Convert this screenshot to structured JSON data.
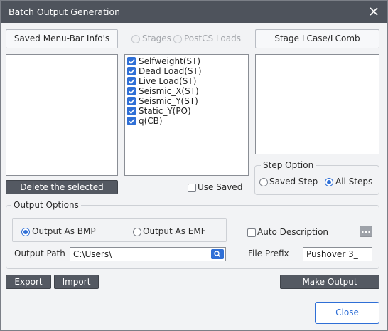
{
  "window": {
    "title": "Batch Output Generation"
  },
  "buttons": {
    "saved_menu": "Saved Menu-Bar Info's",
    "stage_lcase": "Stage LCase/LComb",
    "delete_selected": "Delete the selected",
    "export": "Export",
    "import": "Import",
    "make_output": "Make Output",
    "close": "Close",
    "browse": "..."
  },
  "source": {
    "stages": "Stages",
    "postcs": "PostCS Loads",
    "stages_selected": false,
    "postcs_selected": false
  },
  "load_cases": [
    {
      "label": "Selfweight(ST)",
      "checked": true
    },
    {
      "label": "Dead Load(ST)",
      "checked": true
    },
    {
      "label": "Live Load(ST)",
      "checked": true
    },
    {
      "label": "Seismic_X(ST)",
      "checked": true
    },
    {
      "label": "Seismic_Y(ST)",
      "checked": true
    },
    {
      "label": "Static_Y(PO)",
      "checked": true
    },
    {
      "label": "q(CB)",
      "checked": true
    }
  ],
  "use_saved": {
    "label": "Use Saved",
    "checked": false
  },
  "step_option": {
    "title": "Step Option",
    "saved_step": "Saved Step",
    "all_steps": "All Steps",
    "selected": "all_steps"
  },
  "output_options": {
    "title": "Output Options",
    "bmp": "Output As BMP",
    "emf": "Output As EMF",
    "selected": "bmp",
    "auto_description": {
      "label": "Auto Description",
      "checked": false
    },
    "path_label": "Output Path",
    "path_value": "C:\\Users\\",
    "prefix_label": "File Prefix",
    "prefix_value": "Pushover 3_"
  },
  "colors": {
    "titlebar": "#4e535c",
    "accent": "#2f6fd6",
    "dark_button": "#545962"
  }
}
